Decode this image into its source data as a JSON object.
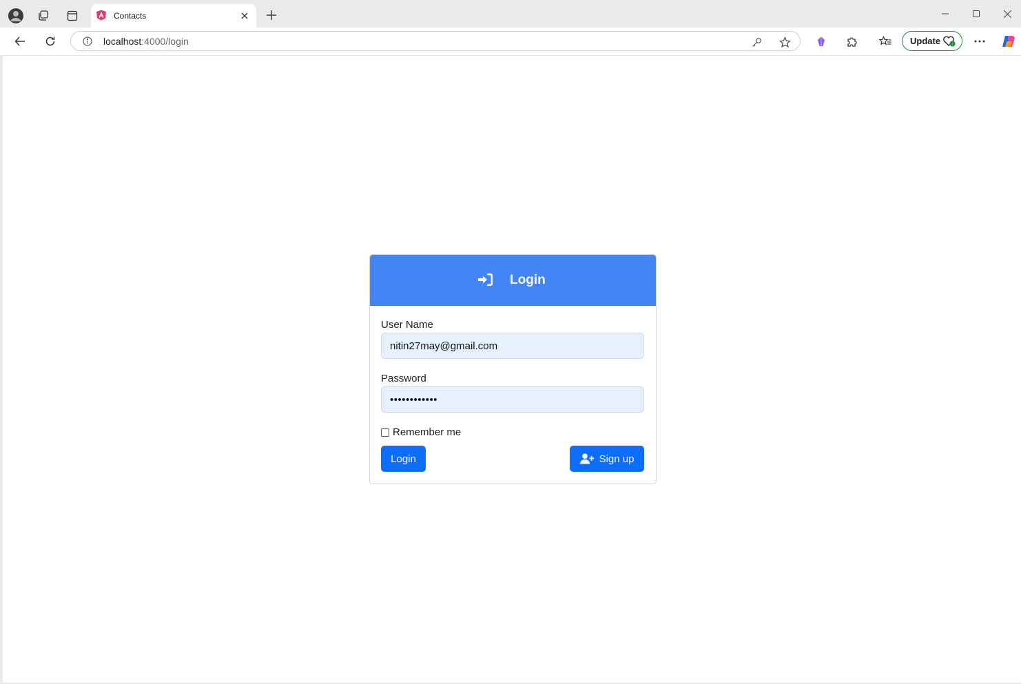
{
  "browser": {
    "tab": {
      "title": "Contacts"
    },
    "address_bar": {
      "host": "localhost",
      "path": ":4000/login"
    },
    "update_button": {
      "label": "Update"
    }
  },
  "login_form": {
    "header_title": "Login",
    "username": {
      "label": "User Name",
      "value": "nitin27may@gmail.com"
    },
    "password": {
      "label": "Password",
      "value": "••••••••••••"
    },
    "remember_label": "Remember me",
    "login_button": "Login",
    "signup_button": "Sign up"
  },
  "colors": {
    "header_blue": "#4285f4",
    "button_blue": "#0d6efd",
    "input_fill": "#e8f0fe"
  }
}
